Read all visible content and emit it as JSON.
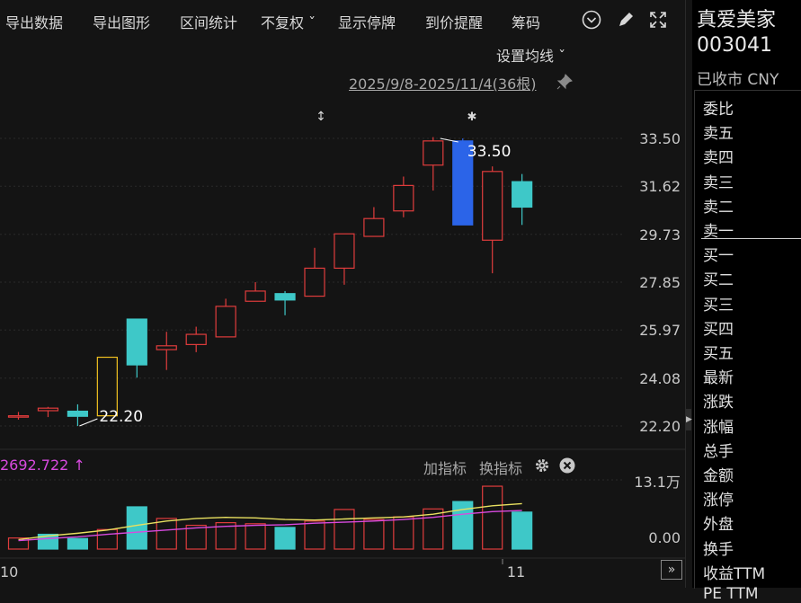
{
  "toolbar": {
    "items": [
      "导出数据",
      "导出图形",
      "区间统计",
      "不复权 ˇ",
      "显示停牌",
      "到价提醒",
      "筹码"
    ],
    "icons": [
      "chevron-circle-icon",
      "pen-icon",
      "expand-icon"
    ]
  },
  "chart_header": {
    "ma_setting": "设置均线 ˇ",
    "date_range": "2025/9/8-2025/11/4(36根)"
  },
  "stock": {
    "name": "真爱美家",
    "code": "003041",
    "status": "已收市 CNY"
  },
  "quote_labels": [
    "委比",
    "卖五",
    "卖四",
    "卖三",
    "卖二",
    "卖一",
    "买一",
    "买二",
    "买三",
    "买四",
    "买五",
    "最新",
    "涨跌",
    "涨幅",
    "总手",
    "金额",
    "涨停",
    "外盘",
    "换手",
    "收益TTM",
    "PE TTM"
  ],
  "indicator": {
    "value": "2692.722 ↑",
    "add_label": "加指标",
    "switch_label": "换指标"
  },
  "colors": {
    "up": "#e03c3c",
    "down": "#3ec8c8",
    "selected": "#2b64e8",
    "highlight": "#f0c020",
    "ma_yellow": "#e8e060",
    "ma_magenta": "#d84adf"
  },
  "chart_data": [
    {
      "type": "candlestick",
      "y_ticks": [
        "33.50",
        "31.62",
        "29.73",
        "27.85",
        "25.97",
        "24.08",
        "22.20"
      ],
      "ylim": [
        22.2,
        33.5
      ],
      "annotations": [
        {
          "text": "33.50"
        },
        {
          "text": "22.20"
        }
      ],
      "candles": [
        {
          "o": 22.55,
          "c": 22.6,
          "h": 22.75,
          "l": 22.45,
          "dir": "up"
        },
        {
          "o": 22.9,
          "c": 22.8,
          "h": 22.95,
          "l": 22.55,
          "dir": "up"
        },
        {
          "o": 22.78,
          "c": 22.58,
          "h": 23.05,
          "l": 22.2,
          "dir": "down"
        },
        {
          "o": 22.6,
          "c": 24.9,
          "h": 24.9,
          "l": 22.6,
          "dir": "up"
        },
        {
          "o": 24.6,
          "c": 26.4,
          "h": 26.4,
          "l": 24.1,
          "dir": "down"
        },
        {
          "o": 25.2,
          "c": 25.35,
          "h": 25.9,
          "l": 24.4,
          "dir": "up"
        },
        {
          "o": 25.4,
          "c": 25.8,
          "h": 26.1,
          "l": 25.1,
          "dir": "up"
        },
        {
          "o": 25.7,
          "c": 26.9,
          "h": 27.2,
          "l": 25.7,
          "dir": "up"
        },
        {
          "o": 27.5,
          "c": 27.1,
          "h": 27.85,
          "l": 27.1,
          "dir": "up"
        },
        {
          "o": 27.4,
          "c": 27.15,
          "h": 27.5,
          "l": 26.55,
          "dir": "down"
        },
        {
          "o": 27.3,
          "c": 28.4,
          "h": 29.2,
          "l": 27.3,
          "dir": "up"
        },
        {
          "o": 28.4,
          "c": 29.75,
          "h": 29.75,
          "l": 27.75,
          "dir": "up"
        },
        {
          "o": 29.65,
          "c": 30.35,
          "h": 30.8,
          "l": 29.65,
          "dir": "up"
        },
        {
          "o": 30.65,
          "c": 31.65,
          "h": 32.0,
          "l": 30.4,
          "dir": "up"
        },
        {
          "o": 32.45,
          "c": 33.4,
          "h": 33.55,
          "l": 31.45,
          "dir": "up"
        },
        {
          "o": 33.4,
          "c": 30.1,
          "h": 33.5,
          "l": 30.1,
          "dir": "selected"
        },
        {
          "o": 29.5,
          "c": 32.2,
          "h": 32.4,
          "l": 28.2,
          "dir": "up"
        },
        {
          "o": 31.8,
          "c": 30.8,
          "h": 32.1,
          "l": 30.1,
          "dir": "down"
        }
      ]
    },
    {
      "type": "bar",
      "y_ticks": [
        "13.1万",
        "0.00"
      ],
      "ylim": [
        0,
        13.1
      ],
      "x_ticks": [
        "10",
        "11"
      ],
      "volumes": [
        2.1,
        2.8,
        2.0,
        3.7,
        8.0,
        5.8,
        4.5,
        5.0,
        4.8,
        4.1,
        5.3,
        7.5,
        5.6,
        6.1,
        7.6,
        9.0,
        11.9,
        7.0
      ],
      "vol_dirs": [
        "up",
        "down",
        "down",
        "up",
        "down",
        "up",
        "up",
        "up",
        "up",
        "down",
        "up",
        "up",
        "up",
        "up",
        "up",
        "down",
        "up",
        "down"
      ],
      "ma_yellow": [
        1.8,
        2.5,
        3.0,
        3.6,
        4.5,
        5.3,
        5.8,
        6.0,
        5.9,
        5.6,
        5.5,
        5.7,
        5.9,
        6.1,
        6.6,
        7.5,
        8.2,
        8.6
      ],
      "ma_magenta": [
        1.6,
        2.0,
        2.3,
        2.8,
        3.2,
        3.6,
        4.0,
        4.3,
        4.5,
        4.6,
        4.9,
        5.1,
        5.3,
        5.6,
        6.0,
        6.6,
        7.1,
        7.3
      ]
    }
  ]
}
